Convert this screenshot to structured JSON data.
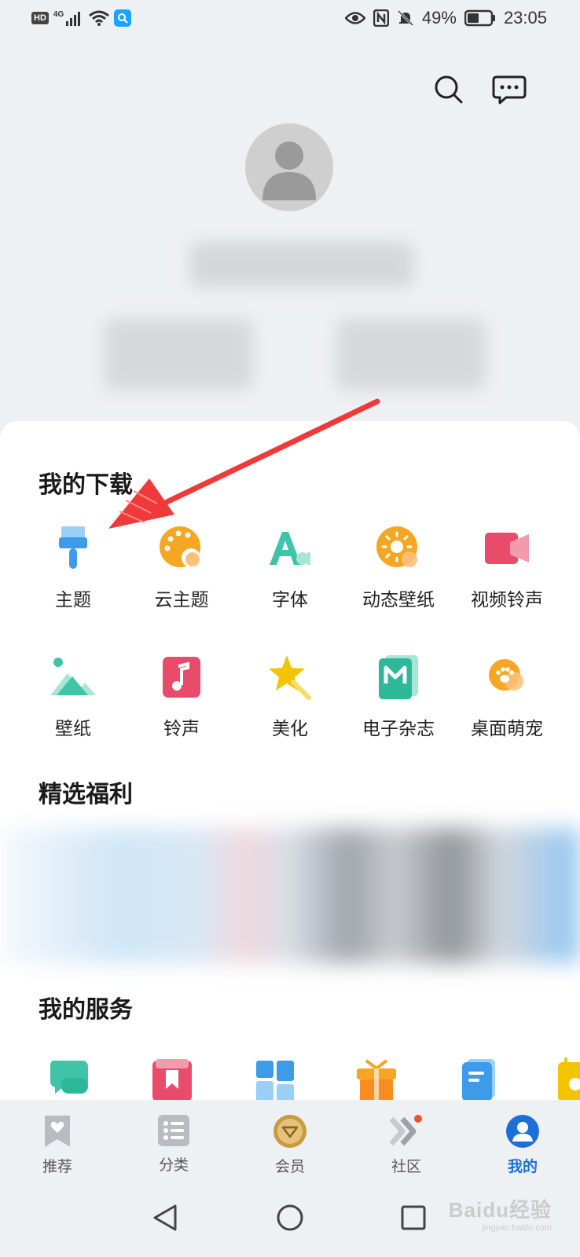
{
  "status_bar": {
    "hd_badge": "HD",
    "network": "4G",
    "battery": "49%",
    "time": "23:05"
  },
  "header": {
    "search_icon": "search-icon",
    "message_icon": "message-icon"
  },
  "downloads": {
    "title": "我的下载",
    "items": [
      {
        "label": "主题",
        "icon": "brush-icon",
        "color": "#3d9be9"
      },
      {
        "label": "云主题",
        "icon": "palette-icon",
        "color": "#f5a623"
      },
      {
        "label": "字体",
        "icon": "font-icon",
        "color": "#3fc4a8"
      },
      {
        "label": "动态壁纸",
        "icon": "live-wallpaper-icon",
        "color": "#f5a623"
      },
      {
        "label": "视频铃声",
        "icon": "video-ringtone-icon",
        "color": "#e94b6a"
      },
      {
        "label": "壁纸",
        "icon": "wallpaper-icon",
        "color": "#3fc4a8"
      },
      {
        "label": "铃声",
        "icon": "ringtone-icon",
        "color": "#e94b6a"
      },
      {
        "label": "美化",
        "icon": "star-wand-icon",
        "color": "#f2c500"
      },
      {
        "label": "电子杂志",
        "icon": "magazine-icon",
        "color": "#2eb89a"
      },
      {
        "label": "桌面萌宠",
        "icon": "pet-paw-icon",
        "color": "#f5a623"
      }
    ]
  },
  "benefits": {
    "title": "精选福利"
  },
  "services": {
    "title": "我的服务",
    "icons": [
      "chat-bubbles-icon",
      "bookmark-book-icon",
      "widgets-icon",
      "gift-icon",
      "document-icon",
      "calendar-icon"
    ]
  },
  "tabs": [
    {
      "label": "推荐",
      "icon": "recommend-icon"
    },
    {
      "label": "分类",
      "icon": "category-icon"
    },
    {
      "label": "会员",
      "icon": "vip-icon"
    },
    {
      "label": "社区",
      "icon": "community-icon"
    },
    {
      "label": "我的",
      "icon": "profile-icon"
    }
  ],
  "active_tab": "我的",
  "accent_color": "#1d6fd8",
  "watermark": {
    "brand": "Baidu经验",
    "sub": "jingyan.baidu.com"
  }
}
